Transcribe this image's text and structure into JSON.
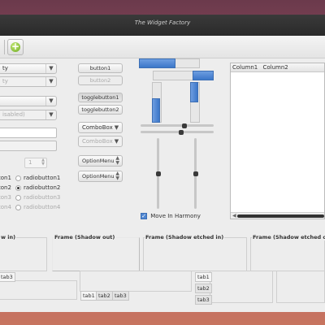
{
  "window": {
    "title": "The Widget Factory"
  },
  "left_column": {
    "combo_1": "ty",
    "combo_2": "ty",
    "combo_3": "",
    "combo_4": "isabled)",
    "entry_1": "",
    "entry_2": "",
    "spin_value": "1",
    "radios_col1": [
      "ton1",
      "ton2",
      "ton3",
      "ton4"
    ],
    "radios_col2": [
      "radiobutton1",
      "radiobutton2",
      "radiobutton3",
      "radiobutton4"
    ],
    "radio_selected_index": 1
  },
  "buttons": {
    "button1": "button1",
    "button2": "button2",
    "togglebutton1": "togglebutton1",
    "togglebutton2": "togglebutton2",
    "combobox1": "ComboBox",
    "combobox2": "ComboBox",
    "optionmenu1": "OptionMenu",
    "optionmenu2": "OptionMenu"
  },
  "progress": {
    "horizontal_1": 0.6,
    "horizontal_2": 0.35,
    "vertical_1": 0.6,
    "vertical_2": 0.5
  },
  "scales": {
    "horizontal_1": 0.6,
    "horizontal_2": 0.55,
    "vertical_1": 0.5,
    "vertical_2": 0.5
  },
  "checkbox": {
    "label": "Move In Harmony",
    "checked": true
  },
  "treeview": {
    "columns": [
      "Column1",
      "Column2"
    ]
  },
  "frames": [
    "w in)",
    "Frame (Shadow out)",
    "Frame (Shadow etched in)",
    "Frame (Shadow etched out)"
  ],
  "notebooks": {
    "nb1_tabs": [
      "tab3"
    ],
    "nb2_tabs": [
      "tab1",
      "tab2",
      "tab3"
    ],
    "nb3_tabs": [
      "tab1",
      "tab2",
      "tab3"
    ]
  },
  "icons": {
    "toolbar_add": "plus-circle-icon"
  },
  "colors": {
    "accent": "#3c77c9",
    "window_bg": "#ededed",
    "titlebar_bg": "#2f2f2f"
  }
}
